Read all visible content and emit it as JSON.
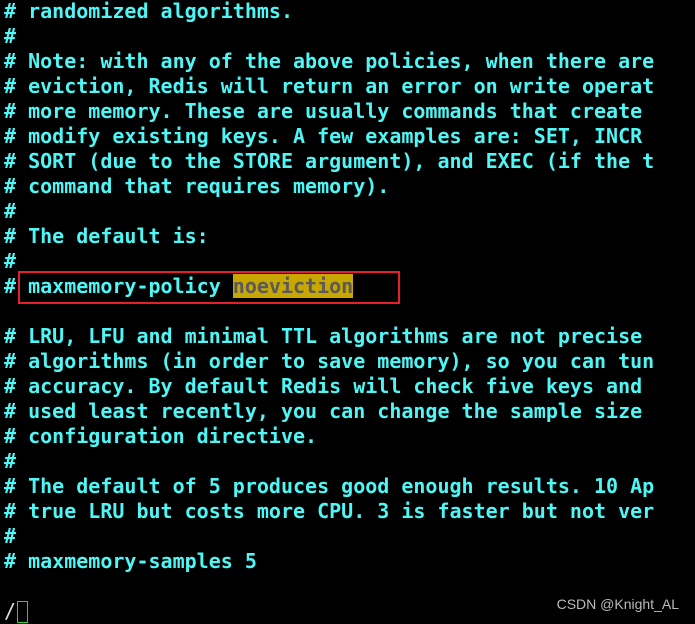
{
  "lines": [
    "# randomized algorithms.",
    "#",
    "# Note: with any of the above policies, when there are",
    "# eviction, Redis will return an error on write operat",
    "# more memory. These are usually commands that create",
    "# modify existing keys. A few examples are: SET, INCR",
    "# SORT (due to the STORE argument), and EXEC (if the t",
    "# command that requires memory).",
    "#",
    "# The default is:",
    "#"
  ],
  "policy_line": {
    "prefix": "# maxmemory-policy ",
    "match": "noeviction"
  },
  "lines2": [
    "",
    "# LRU, LFU and minimal TTL algorithms are not precise",
    "# algorithms (in order to save memory), so you can tun",
    "# accuracy. By default Redis will check five keys and",
    "# used least recently, you can change the sample size",
    "# configuration directive.",
    "#",
    "# The default of 5 produces good enough results. 10 Ap",
    "# true LRU but costs more CPU. 3 is faster but not ver",
    "#",
    "# maxmemory-samples 5",
    ""
  ],
  "command_line": "/",
  "watermark": "CSDN @Knight_AL",
  "colors": {
    "text": "#4ff6f6",
    "search_highlight": "#c8a800",
    "annotation_box": "#e5202a"
  }
}
